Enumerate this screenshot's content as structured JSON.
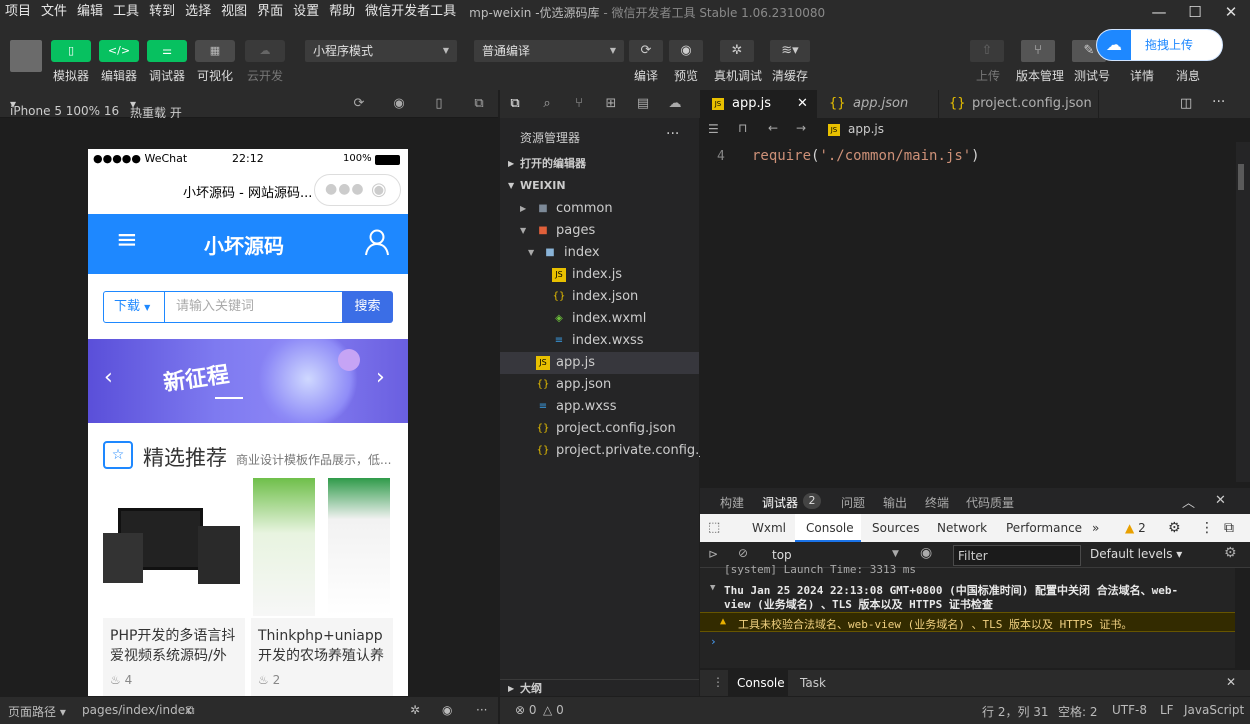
{
  "menu": [
    "项目",
    "文件",
    "编辑",
    "工具",
    "转到",
    "选择",
    "视图",
    "界面",
    "设置",
    "帮助",
    "微信开发者工具"
  ],
  "window": {
    "title": "mp-weixin -优选源码库",
    "subtitle": "- 微信开发者工具 Stable 1.06.2310080"
  },
  "toolbar": {
    "simulator": "模拟器",
    "editor": "编辑器",
    "debugger": "调试器",
    "visual": "可视化",
    "cloud": "云开发",
    "mode_select": "小程序模式",
    "compile_select": "普通编译",
    "compile": "编译",
    "preview": "预览",
    "remote_debug": "真机调试",
    "clear_cache": "清缓存",
    "upload": "上传",
    "version": "版本管理",
    "test_id": "测试号",
    "details": "详情",
    "messages": "消息",
    "drag_upload": "拖拽上传"
  },
  "sim_header": {
    "device": "iPhone 5 100% 16",
    "hot_reload": "热重载 开"
  },
  "phone": {
    "status_left": "●●●●● WeChat",
    "status_time": "22:12",
    "status_battery": "100%",
    "nav_title": "小坏源码 - 网站源码...",
    "app_logo": "小坏源码",
    "download_btn": "下载",
    "search_placeholder": "请输入关键词",
    "search_btn": "搜索",
    "banner_text": "新征程",
    "section_title": "精选推荐",
    "section_sub": "商业设计模板作品展示，低...",
    "cards": [
      {
        "title1": "PHP开发的多语言抖",
        "title2": "爱视频系统源码/外",
        "likes": "4"
      },
      {
        "title1": "Thinkphp+uniapp",
        "title2": "开发的农场养殖认养",
        "likes": "2"
      }
    ]
  },
  "explorer": {
    "title": "资源管理器",
    "open_editors": "打开的编辑器",
    "root": "WEIXIN",
    "items": [
      "common",
      "pages",
      "index",
      "index.js",
      "index.json",
      "index.wxml",
      "index.wxss",
      "app.js",
      "app.json",
      "app.wxss",
      "project.config.json",
      "project.private.config.js..."
    ],
    "outline": "大纲"
  },
  "editor": {
    "tabs": [
      "app.js",
      "app.json",
      "project.config.json"
    ],
    "breadcrumb": "app.js",
    "line_no": "4",
    "code_fn": "require",
    "code_str": "'./common/main.js'"
  },
  "debugger": {
    "tabs": [
      "构建",
      "调试器",
      "问题",
      "输出",
      "终端",
      "代码质量"
    ],
    "badge": "2",
    "devtools_tabs": [
      "Wxml",
      "Console",
      "Sources",
      "Network",
      "Performance"
    ],
    "warn_count": "2",
    "context": "top",
    "filter_placeholder": "Filter",
    "levels": "Default levels",
    "log_partial": "[system] Launch Time: 3313 ms",
    "log_group1": "Thu Jan 25 2024 22:13:08 GMT+0800 (中国标准时间) 配置中关闭 合法域名、web-",
    "log_group2": "view (业务域名) 、TLS 版本以及 HTTPS 证书检查",
    "log_warn": "工具未校验合法域名、web-view (业务域名) 、TLS 版本以及 HTTPS 证书。",
    "bottom_tabs": [
      "Console",
      "Task"
    ]
  },
  "status": {
    "page_path_label": "页面路径",
    "page_path": "pages/index/index",
    "errors": "0",
    "warnings": "0",
    "cursor": "行 2，列 31",
    "spaces": "空格: 2",
    "encoding": "UTF-8",
    "eol": "LF",
    "language": "JavaScript"
  },
  "colors": {
    "accent_green": "#07c160",
    "brand_blue": "#1e88ff",
    "editor_bg": "#1e1e1e",
    "keyword_orange": "#ce9178"
  }
}
